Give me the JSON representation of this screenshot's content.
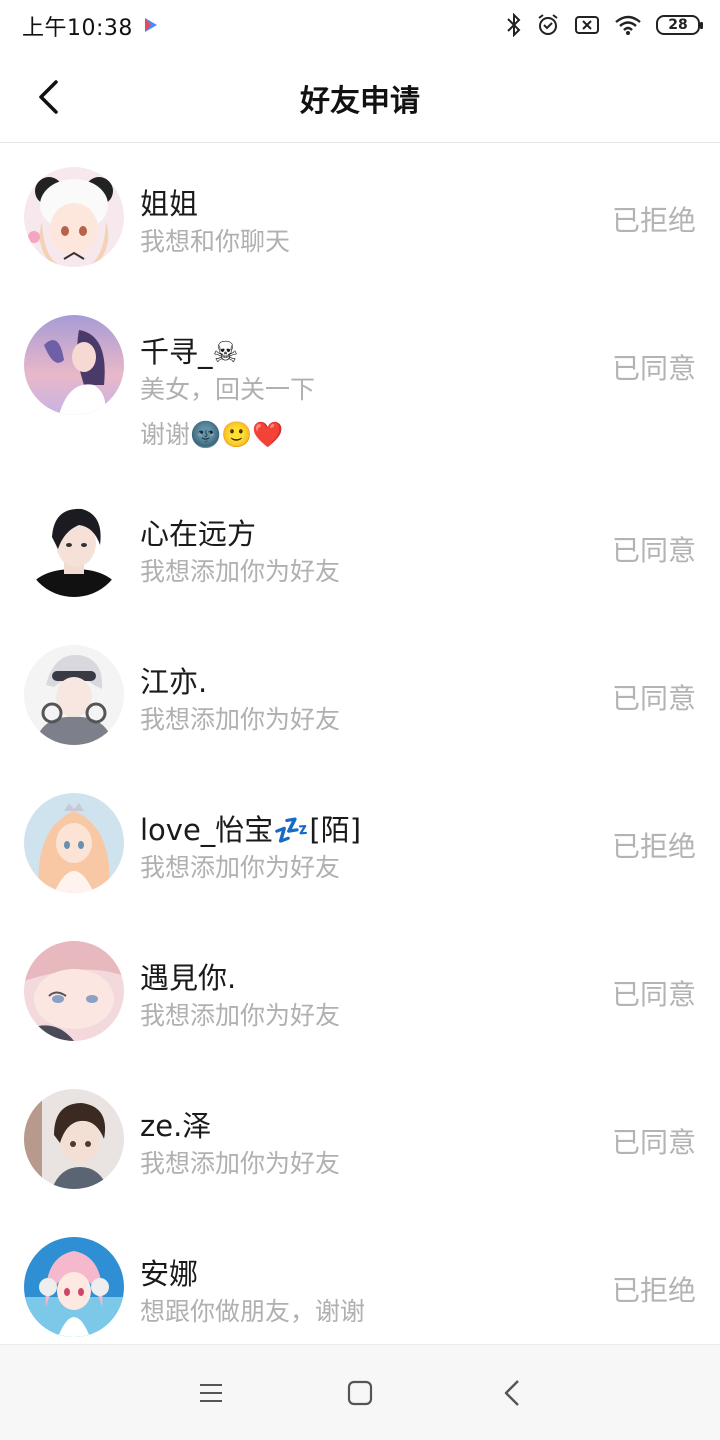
{
  "status_bar": {
    "time": "上午10:38",
    "battery": "28"
  },
  "header": {
    "title": "好友申请"
  },
  "requests": [
    {
      "name": "姐姐",
      "message": "我想和你聊天",
      "message2": "",
      "status": "已拒绝",
      "avatar": "anime-girl-panda-hood"
    },
    {
      "name": "千寻_☠",
      "message": "美女，回关一下",
      "message2": "谢谢🌚🙂❤️",
      "status": "已同意",
      "avatar": "anime-girl-purple-sky"
    },
    {
      "name": "心在远方",
      "message": "我想添加你为好友",
      "message2": "",
      "status": "已同意",
      "avatar": "anime-boy-dark-hair"
    },
    {
      "name": "江亦.",
      "message": "我想添加你为好友",
      "message2": "",
      "status": "已同意",
      "avatar": "anime-boy-silver-hair"
    },
    {
      "name": "love_怡宝💤[陌]",
      "message": "我想添加你为好友",
      "message2": "",
      "status": "已拒绝",
      "avatar": "anime-girl-pink-hair"
    },
    {
      "name": "遇見你.",
      "message": "我想添加你为好友",
      "message2": "",
      "status": "已同意",
      "avatar": "anime-girl-closeup"
    },
    {
      "name": "ze.泽",
      "message": "我想添加你为好友",
      "message2": "",
      "status": "已同意",
      "avatar": "anime-boy-brown-hair"
    },
    {
      "name": "安娜",
      "message": "想跟你做朋友，谢谢",
      "message2": "",
      "status": "已拒绝",
      "avatar": "anime-girl-headphones"
    }
  ],
  "colors": {
    "text_primary": "#1a1a1a",
    "text_secondary": "#b0b0b0",
    "status_text": "#b3b3b3",
    "divider": "#e6e6e6",
    "nav_bg": "#f7f7f7"
  },
  "nav": {
    "icons": [
      "menu-icon",
      "home-square-icon",
      "back-triangle-icon"
    ]
  }
}
